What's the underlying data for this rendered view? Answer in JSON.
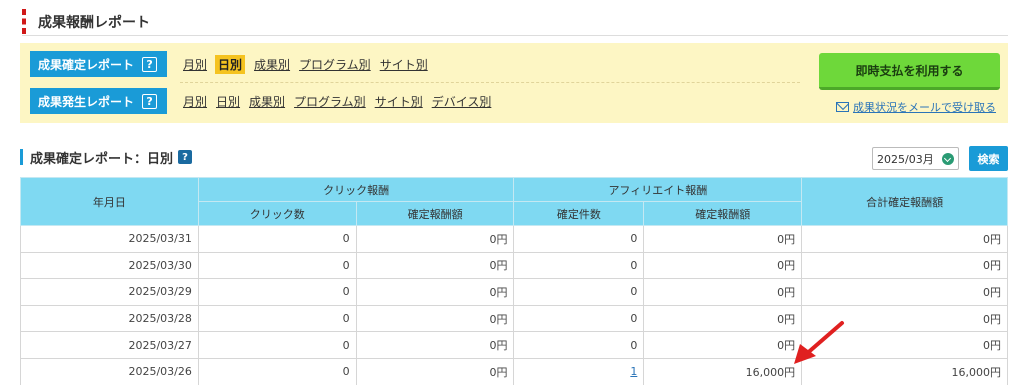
{
  "page": {
    "title": "成果報酬レポート"
  },
  "confirmed_row": {
    "label": "成果確定レポート",
    "help": "?",
    "links": [
      {
        "label": "月別"
      },
      {
        "label": "日別",
        "active": true
      },
      {
        "label": "成果別"
      },
      {
        "label": "プログラム別"
      },
      {
        "label": "サイト別"
      }
    ]
  },
  "occurred_row": {
    "label": "成果発生レポート",
    "help": "?",
    "links": [
      {
        "label": "月別"
      },
      {
        "label": "日別"
      },
      {
        "label": "成果別"
      },
      {
        "label": "プログラム別"
      },
      {
        "label": "サイト別"
      },
      {
        "label": "デバイス別"
      }
    ]
  },
  "instant_payment_button": "即時支払を利用する",
  "mail_link": "成果状況をメールで受け取る",
  "section": {
    "title": "成果確定レポート：日別",
    "help": "?",
    "month_value": "2025/03月",
    "search_label": "検索"
  },
  "table": {
    "header": {
      "date": "年月日",
      "click_group": "クリック報酬",
      "affiliate_group": "アフィリエイト報酬",
      "total": "合計確定報酬額",
      "click_count": "クリック数",
      "click_amount": "確定報酬額",
      "affiliate_count": "確定件数",
      "affiliate_amount": "確定報酬額"
    },
    "rows": [
      {
        "date": "2025/03/31",
        "clicks": "0",
        "click_amount": "0円",
        "count": "0",
        "amount": "0円",
        "total": "0円"
      },
      {
        "date": "2025/03/30",
        "clicks": "0",
        "click_amount": "0円",
        "count": "0",
        "amount": "0円",
        "total": "0円"
      },
      {
        "date": "2025/03/29",
        "clicks": "0",
        "click_amount": "0円",
        "count": "0",
        "amount": "0円",
        "total": "0円"
      },
      {
        "date": "2025/03/28",
        "clicks": "0",
        "click_amount": "0円",
        "count": "0",
        "amount": "0円",
        "total": "0円"
      },
      {
        "date": "2025/03/27",
        "clicks": "0",
        "click_amount": "0円",
        "count": "0",
        "amount": "0円",
        "total": "0円"
      },
      {
        "date": "2025/03/26",
        "clicks": "0",
        "click_amount": "0円",
        "count": "1",
        "amount": "16,000円",
        "total": "16,000円"
      }
    ]
  },
  "colors": {
    "accent_blue": "#1a9bd7",
    "panel_yellow": "#fdf6c4",
    "table_header": "#7fd9f2",
    "button_green": "#6ed83a",
    "annotation_red": "#e02020"
  }
}
